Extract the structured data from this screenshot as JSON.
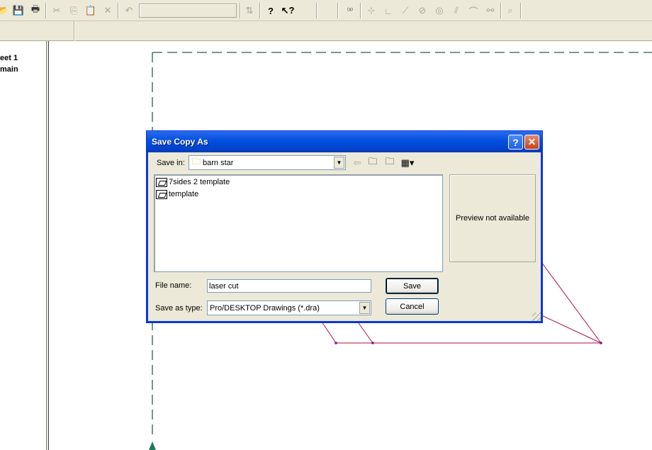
{
  "sidebar": {
    "items": [
      {
        "label": "eet 1"
      },
      {
        "label": "main"
      }
    ]
  },
  "toolbar": {
    "icons": [
      "open-icon",
      "save-icon",
      "print-icon",
      "cut-icon",
      "copy-icon",
      "paste-icon",
      "delete-icon",
      "undo-icon",
      "combo-empty",
      "switch-icon",
      "help-icon",
      "whats-this-icon",
      "constraint-icon",
      "grid-icon",
      "perpendicular-icon",
      "line-icon",
      "circle-icon",
      "concentric-icon",
      "parallel-icon",
      "arc-icon",
      "link-icon",
      "zoom-icon"
    ]
  },
  "dialog": {
    "title": "Save Copy As",
    "help_label": "?",
    "close_label": "✕",
    "save_in_label": "Save in:",
    "save_in_value": "barn star",
    "files": [
      {
        "name": "7sides 2 template"
      },
      {
        "name": "template"
      }
    ],
    "preview_text": "Preview not available",
    "file_name_label": "File name:",
    "file_name_value": "laser cut",
    "save_type_label": "Save as type:",
    "save_type_value": "Pro/DESKTOP Drawings (*.dra)",
    "save_button": "Save",
    "cancel_button": "Cancel"
  },
  "colors": {
    "dialog_title_blue": "#0047d4",
    "sketch_line": "#b01040",
    "frame_dash": "#2e5a4a",
    "arrow_green": "#1a7a5a"
  }
}
